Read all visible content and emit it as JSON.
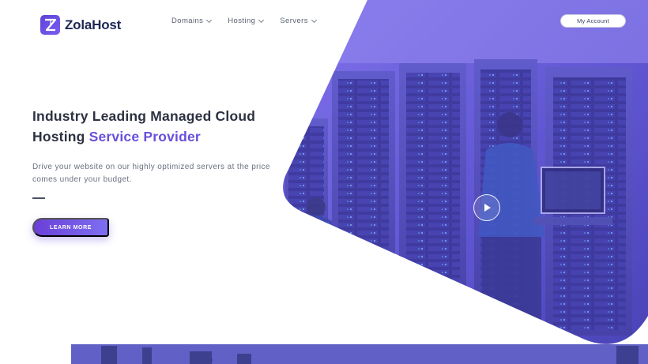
{
  "header": {
    "logo_text": "ZolaHost",
    "nav": [
      {
        "label": "Domains"
      },
      {
        "label": "Hosting"
      },
      {
        "label": "Servers"
      }
    ],
    "account_label": "My Account"
  },
  "hero": {
    "title_line1": "Industry Leading Managed Cloud",
    "title_line2_plain": "Hosting ",
    "title_line2_accent": "Service Provider",
    "subtitle_line1": "Drive your website on our highly optimized servers at the price",
    "subtitle_line2": "comes under your budget.",
    "cta_label": "LEARN MORE",
    "play_icon": "play-icon"
  },
  "colors": {
    "accent": "#6a4fdc",
    "overlay": "#6b5ce0",
    "text_dark": "#2d3242"
  }
}
